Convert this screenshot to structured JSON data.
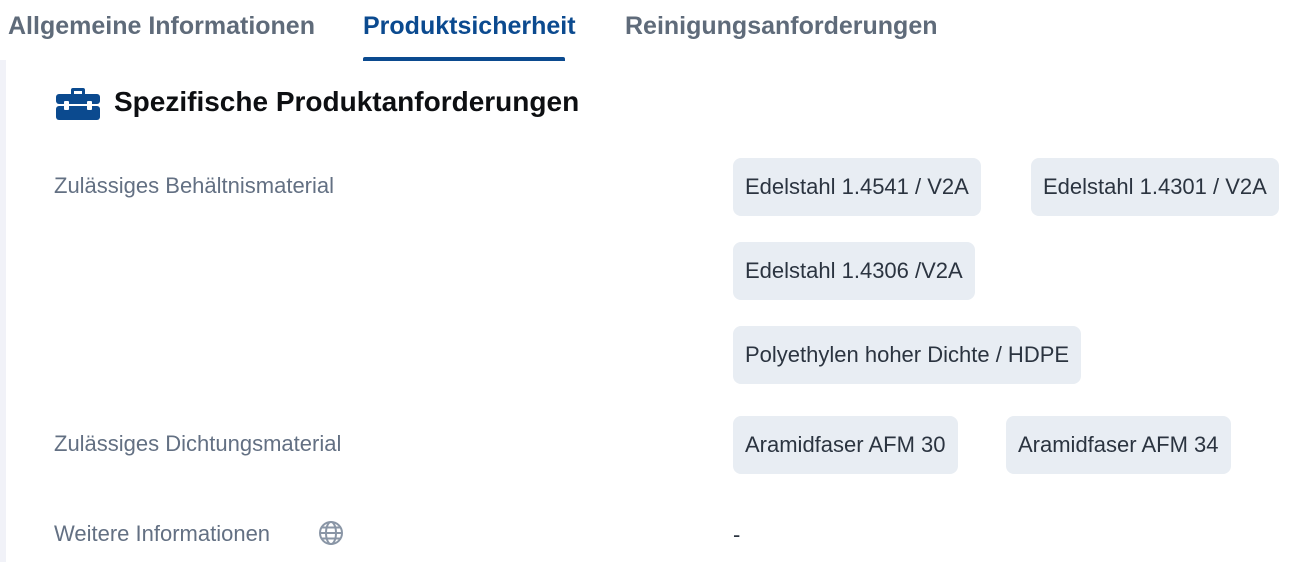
{
  "tabs": [
    {
      "label": "Allgemeine Informationen",
      "active": false
    },
    {
      "label": "Produktsicherheit",
      "active": true
    },
    {
      "label": "Reinigungsanforderungen",
      "active": false
    }
  ],
  "section": {
    "icon": "toolbox-icon",
    "title": "Spezifische Produktanforderungen"
  },
  "rows": {
    "container_material": {
      "label": "Zulässiges Behältnismaterial",
      "values": [
        "Edelstahl 1.4541 / V2A",
        "Edelstahl 1.4301 / V2A",
        "Edelstahl 1.4306 /V2A",
        "Polyethylen hoher Dichte / HDPE"
      ]
    },
    "seal_material": {
      "label": "Zulässiges Dichtungsmaterial",
      "values": [
        "Aramidfaser AFM 30",
        "Aramidfaser AFM 34"
      ]
    },
    "further_info": {
      "label": "Weitere Informationen",
      "icon": "globe-icon",
      "value": "-"
    }
  },
  "colors": {
    "accent": "#0b4a8f",
    "chip_bg": "#e8edf3",
    "label": "#637083",
    "tab_inactive": "#5f6b7a"
  }
}
